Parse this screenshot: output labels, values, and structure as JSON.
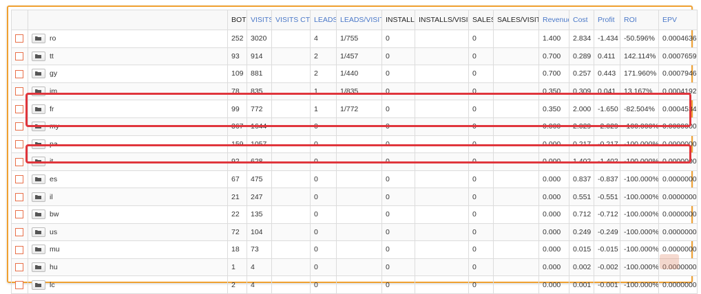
{
  "columns": [
    "",
    "",
    "BOT",
    "VISITS",
    "VISITS CTR",
    "LEADS",
    "LEADS/VISITS",
    "INSTALLS",
    "INSTALLS/VISIT",
    "SALES",
    "SALES/VISIT",
    "Revenue",
    "Cost",
    "Profit",
    "ROI",
    "EPV"
  ],
  "rows": [
    {
      "name": "ro",
      "bot": "252",
      "visits": "3020",
      "ctr": "",
      "leads": "4",
      "lv": "1/755",
      "installs": "0",
      "iv": "",
      "sales": "0",
      "sv": "",
      "revenue": "1.400",
      "cost": "2.834",
      "profit": "-1.434",
      "roi": "-50.596%",
      "epv": "0.0004636"
    },
    {
      "name": "tt",
      "bot": "93",
      "visits": "914",
      "ctr": "",
      "leads": "2",
      "lv": "1/457",
      "installs": "0",
      "iv": "",
      "sales": "0",
      "sv": "",
      "revenue": "0.700",
      "cost": "0.289",
      "profit": "0.411",
      "roi": "142.114%",
      "epv": "0.0007659"
    },
    {
      "name": "gy",
      "bot": "109",
      "visits": "881",
      "ctr": "",
      "leads": "2",
      "lv": "1/440",
      "installs": "0",
      "iv": "",
      "sales": "0",
      "sv": "",
      "revenue": "0.700",
      "cost": "0.257",
      "profit": "0.443",
      "roi": "171.960%",
      "epv": "0.0007946"
    },
    {
      "name": "jm",
      "bot": "78",
      "visits": "835",
      "ctr": "",
      "leads": "1",
      "lv": "1/835",
      "installs": "0",
      "iv": "",
      "sales": "0",
      "sv": "",
      "revenue": "0.350",
      "cost": "0.309",
      "profit": "0.041",
      "roi": "13.167%",
      "epv": "0.0004192"
    },
    {
      "name": "fr",
      "bot": "99",
      "visits": "772",
      "ctr": "",
      "leads": "1",
      "lv": "1/772",
      "installs": "0",
      "iv": "",
      "sales": "0",
      "sv": "",
      "revenue": "0.350",
      "cost": "2.000",
      "profit": "-1.650",
      "roi": "-82.504%",
      "epv": "0.0004534"
    },
    {
      "name": "my",
      "bot": "367",
      "visits": "1644",
      "ctr": "",
      "leads": "0",
      "lv": "",
      "installs": "0",
      "iv": "",
      "sales": "0",
      "sv": "",
      "revenue": "0.000",
      "cost": "2.029",
      "profit": "-2.029",
      "roi": "-100.000%",
      "epv": "0.0000000"
    },
    {
      "name": "pa",
      "bot": "159",
      "visits": "1057",
      "ctr": "",
      "leads": "0",
      "lv": "",
      "installs": "0",
      "iv": "",
      "sales": "0",
      "sv": "",
      "revenue": "0.000",
      "cost": "0.217",
      "profit": "-0.217",
      "roi": "-100.000%",
      "epv": "0.0000000"
    },
    {
      "name": "it",
      "bot": "92",
      "visits": "628",
      "ctr": "",
      "leads": "0",
      "lv": "",
      "installs": "0",
      "iv": "",
      "sales": "0",
      "sv": "",
      "revenue": "0.000",
      "cost": "1.402",
      "profit": "-1.402",
      "roi": "-100.000%",
      "epv": "0.0000000"
    },
    {
      "name": "es",
      "bot": "67",
      "visits": "475",
      "ctr": "",
      "leads": "0",
      "lv": "",
      "installs": "0",
      "iv": "",
      "sales": "0",
      "sv": "",
      "revenue": "0.000",
      "cost": "0.837",
      "profit": "-0.837",
      "roi": "-100.000%",
      "epv": "0.0000000"
    },
    {
      "name": "il",
      "bot": "21",
      "visits": "247",
      "ctr": "",
      "leads": "0",
      "lv": "",
      "installs": "0",
      "iv": "",
      "sales": "0",
      "sv": "",
      "revenue": "0.000",
      "cost": "0.551",
      "profit": "-0.551",
      "roi": "-100.000%",
      "epv": "0.0000000"
    },
    {
      "name": "bw",
      "bot": "22",
      "visits": "135",
      "ctr": "",
      "leads": "0",
      "lv": "",
      "installs": "0",
      "iv": "",
      "sales": "0",
      "sv": "",
      "revenue": "0.000",
      "cost": "0.712",
      "profit": "-0.712",
      "roi": "-100.000%",
      "epv": "0.0000000"
    },
    {
      "name": "us",
      "bot": "72",
      "visits": "104",
      "ctr": "",
      "leads": "0",
      "lv": "",
      "installs": "0",
      "iv": "",
      "sales": "0",
      "sv": "",
      "revenue": "0.000",
      "cost": "0.249",
      "profit": "-0.249",
      "roi": "-100.000%",
      "epv": "0.0000000"
    },
    {
      "name": "mu",
      "bot": "18",
      "visits": "73",
      "ctr": "",
      "leads": "0",
      "lv": "",
      "installs": "0",
      "iv": "",
      "sales": "0",
      "sv": "",
      "revenue": "0.000",
      "cost": "0.015",
      "profit": "-0.015",
      "roi": "-100.000%",
      "epv": "0.0000000"
    },
    {
      "name": "hu",
      "bot": "1",
      "visits": "4",
      "ctr": "",
      "leads": "0",
      "lv": "",
      "installs": "0",
      "iv": "",
      "sales": "0",
      "sv": "",
      "revenue": "0.000",
      "cost": "0.002",
      "profit": "-0.002",
      "roi": "-100.000%",
      "epv": "0.0000000"
    },
    {
      "name": "lc",
      "bot": "2",
      "visits": "4",
      "ctr": "",
      "leads": "0",
      "lv": "",
      "installs": "0",
      "iv": "",
      "sales": "0",
      "sv": "",
      "revenue": "0.000",
      "cost": "0.001",
      "profit": "-0.001",
      "roi": "-100.000%",
      "epv": "0.0000000"
    }
  ],
  "highlighted_rows": [
    "fr",
    "my",
    "it"
  ],
  "colors": {
    "frame_border": "#f0a030",
    "highlight": "#e0353c",
    "link_header": "#4a78c8",
    "checkbox": "#e8704a"
  },
  "icons": {
    "row_button": "folder-icon"
  }
}
